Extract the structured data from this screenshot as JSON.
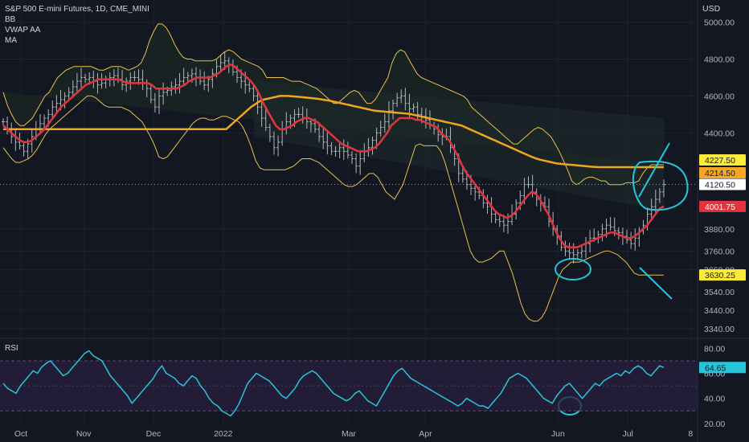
{
  "header": {
    "symbol_line": "S&P 500 E-mini Futures, 1D, CME_MINI",
    "indicators": [
      "BB",
      "VWAP AA",
      "MA"
    ]
  },
  "currency": "USD",
  "rsi_label": "RSI",
  "colors": {
    "background": "#131722",
    "grid": "#1e222d",
    "bb_band": "#e9c14a",
    "bb_fill": "#1a2424",
    "ma_fast": "#e0353f",
    "ma_slow": "#f0a520",
    "candles": "#b2b5be",
    "rsi_line": "#26c6da",
    "rsi_band": "#2a1f3d",
    "annotation": "#26c6da",
    "label_last": "#ffffff",
    "label_upper": "#ffeb3b",
    "label_slow": "#f5a623",
    "label_fast": "#e0353f",
    "label_lower": "#ffeb3b",
    "label_rsi": "#26c6da"
  },
  "chart_data": [
    {
      "type": "line",
      "title": "S&P 500 E-mini Futures, 1D, CME_MINI",
      "x_ticks": [
        "Oct",
        "Nov",
        "Dec",
        "2022",
        "Mar",
        "Apr",
        "Jun",
        "Jul",
        "8"
      ],
      "y_ticks": [
        3340,
        3440,
        3540,
        3660,
        3760,
        3880,
        4000,
        4120,
        4400,
        4600,
        4800,
        5000
      ],
      "y_tick_labels": [
        "3340.00",
        "3440.00",
        "3540.00",
        "3660.00",
        "3760.00",
        "3880.00",
        "4001.75",
        "4120.50",
        "4400.00",
        "4600.00",
        "4800.00",
        "5000.00"
      ],
      "ylim": [
        3300,
        5120
      ],
      "price_labels": [
        {
          "text": "4227.50",
          "value": 4227.5,
          "kind": "upper"
        },
        {
          "text": "4214.50",
          "value": 4214.5,
          "kind": "slow"
        },
        {
          "text": "4120.50",
          "value": 4120.5,
          "kind": "last"
        },
        {
          "text": "4001.75",
          "value": 4001.75,
          "kind": "fast"
        },
        {
          "text": "3630.25",
          "value": 3630.25,
          "kind": "lower"
        }
      ],
      "closes": [
        4460,
        4420,
        4380,
        4350,
        4330,
        4300,
        4340,
        4380,
        4420,
        4450,
        4480,
        4500,
        4540,
        4560,
        4580,
        4600,
        4620,
        4650,
        4680,
        4700,
        4690,
        4700,
        4680,
        4660,
        4670,
        4690,
        4700,
        4710,
        4690,
        4660,
        4680,
        4700,
        4700,
        4690,
        4670,
        4640,
        4580,
        4540,
        4600,
        4620,
        4630,
        4650,
        4660,
        4680,
        4700,
        4710,
        4720,
        4700,
        4680,
        4660,
        4690,
        4720,
        4760,
        4780,
        4790,
        4770,
        4730,
        4700,
        4680,
        4660,
        4640,
        4600,
        4540,
        4480,
        4430,
        4380,
        4320,
        4350,
        4420,
        4460,
        4480,
        4500,
        4500,
        4480,
        4460,
        4450,
        4420,
        4380,
        4350,
        4330,
        4300,
        4300,
        4320,
        4300,
        4280,
        4260,
        4220,
        4260,
        4300,
        4320,
        4360,
        4400,
        4430,
        4460,
        4520,
        4560,
        4590,
        4600,
        4560,
        4530,
        4540,
        4500,
        4490,
        4470,
        4440,
        4420,
        4390,
        4380,
        4380,
        4320,
        4260,
        4180,
        4150,
        4120,
        4100,
        4080,
        4060,
        4020,
        4000,
        3960,
        3930,
        3920,
        3900,
        3920,
        3960,
        4020,
        4060,
        4120,
        4120,
        4080,
        4040,
        4020,
        4000,
        3920,
        3880,
        3840,
        3780,
        3760,
        3750,
        3740,
        3750,
        3760,
        3800,
        3830,
        3830,
        3850,
        3880,
        3900,
        3890,
        3870,
        3860,
        3840,
        3820,
        3800,
        3830,
        3870,
        3900,
        3960,
        4000,
        4040,
        4080,
        4120
      ],
      "series": [
        {
          "name": "BB upper",
          "y": [
            4620,
            4550,
            4500,
            4460,
            4440,
            4440,
            4460,
            4480,
            4520,
            4560,
            4600,
            4620,
            4660,
            4700,
            4720,
            4740,
            4750,
            4760,
            4760,
            4760,
            4760,
            4760,
            4750,
            4740,
            4740,
            4750,
            4760,
            4760,
            4760,
            4750,
            4740,
            4750,
            4760,
            4780,
            4830,
            4900,
            4950,
            4990,
            4990,
            4970,
            4930,
            4880,
            4840,
            4810,
            4800,
            4800,
            4790,
            4790,
            4790,
            4790,
            4790,
            4800,
            4820,
            4840,
            4850,
            4840,
            4820,
            4800,
            4790,
            4780,
            4770,
            4760,
            4740,
            4700,
            4700,
            4700,
            4700,
            4700,
            4690,
            4680,
            4680,
            4680,
            4670,
            4660,
            4650,
            4640,
            4620,
            4600,
            4580,
            4560,
            4560,
            4580,
            4600,
            4620,
            4630,
            4620,
            4590,
            4560,
            4560,
            4580,
            4620,
            4660,
            4700,
            4780,
            4830,
            4850,
            4840,
            4800,
            4760,
            4720,
            4700,
            4690,
            4680,
            4670,
            4660,
            4650,
            4640,
            4630,
            4620,
            4610,
            4600,
            4580,
            4540,
            4520,
            4500,
            4480,
            4460,
            4440,
            4420,
            4400,
            4380,
            4360,
            4340,
            4340,
            4360,
            4380,
            4400,
            4420,
            4430,
            4420,
            4400,
            4380,
            4340,
            4300,
            4250,
            4200,
            4140,
            4120,
            4130,
            4150,
            4160,
            4160,
            4150,
            4140,
            4140,
            4120,
            4120,
            4120,
            4120,
            4130,
            4130,
            4130,
            4140,
            4180,
            4210,
            4227.5,
            4227.5,
            4227.5,
            4227.5
          ]
        },
        {
          "name": "BB lower",
          "y": [
            4320,
            4290,
            4260,
            4240,
            4240,
            4250,
            4260,
            4280,
            4310,
            4350,
            4390,
            4420,
            4440,
            4460,
            4480,
            4500,
            4520,
            4540,
            4560,
            4580,
            4600,
            4600,
            4590,
            4570,
            4550,
            4540,
            4540,
            4540,
            4540,
            4530,
            4520,
            4500,
            4480,
            4460,
            4420,
            4380,
            4330,
            4270,
            4260,
            4270,
            4300,
            4330,
            4360,
            4390,
            4420,
            4450,
            4470,
            4480,
            4480,
            4470,
            4470,
            4480,
            4490,
            4490,
            4480,
            4470,
            4460,
            4430,
            4380,
            4320,
            4250,
            4210,
            4200,
            4200,
            4200,
            4200,
            4200,
            4200,
            4210,
            4220,
            4240,
            4260,
            4260,
            4260,
            4250,
            4240,
            4220,
            4200,
            4180,
            4160,
            4140,
            4120,
            4110,
            4110,
            4120,
            4140,
            4160,
            4180,
            4180,
            4160,
            4120,
            4080,
            4060,
            4040,
            4080,
            4120,
            4190,
            4260,
            4330,
            4340,
            4330,
            4330,
            4330,
            4330,
            4300,
            4240,
            4160,
            4080,
            4000,
            3920,
            3840,
            3760,
            3720,
            3700,
            3700,
            3710,
            3720,
            3740,
            3760,
            3760,
            3700,
            3640,
            3560,
            3480,
            3420,
            3390,
            3380,
            3380,
            3400,
            3440,
            3500,
            3560,
            3620,
            3660,
            3680,
            3700,
            3700,
            3700,
            3710,
            3720,
            3730,
            3740,
            3750,
            3760,
            3760,
            3750,
            3740,
            3720,
            3700,
            3670,
            3640,
            3630.25,
            3630.25,
            3630.25,
            3630.25,
            3630.25,
            3630.25,
            3630.25
          ]
        },
        {
          "name": "MA fast",
          "y": [
            4440,
            4420,
            4400,
            4380,
            4360,
            4350,
            4350,
            4360,
            4380,
            4400,
            4420,
            4450,
            4480,
            4510,
            4540,
            4560,
            4580,
            4600,
            4620,
            4640,
            4660,
            4670,
            4680,
            4690,
            4690,
            4690,
            4690,
            4690,
            4690,
            4680,
            4670,
            4670,
            4670,
            4670,
            4670,
            4670,
            4660,
            4640,
            4640,
            4640,
            4640,
            4640,
            4640,
            4650,
            4660,
            4680,
            4690,
            4700,
            4700,
            4700,
            4700,
            4710,
            4720,
            4740,
            4760,
            4770,
            4760,
            4740,
            4720,
            4700,
            4680,
            4650,
            4610,
            4560,
            4520,
            4480,
            4440,
            4420,
            4420,
            4430,
            4440,
            4460,
            4470,
            4480,
            4480,
            4470,
            4460,
            4440,
            4420,
            4400,
            4380,
            4360,
            4340,
            4330,
            4320,
            4310,
            4300,
            4300,
            4300,
            4310,
            4320,
            4340,
            4370,
            4400,
            4440,
            4460,
            4480,
            4480,
            4480,
            4480,
            4470,
            4470,
            4460,
            4450,
            4440,
            4430,
            4400,
            4380,
            4360,
            4320,
            4280,
            4230,
            4190,
            4160,
            4130,
            4100,
            4070,
            4040,
            4010,
            3980,
            3960,
            3950,
            3940,
            3950,
            3970,
            4000,
            4030,
            4060,
            4080,
            4070,
            4040,
            4000,
            3960,
            3910,
            3860,
            3820,
            3790,
            3780,
            3780,
            3780,
            3790,
            3800,
            3810,
            3820,
            3830,
            3840,
            3850,
            3860,
            3860,
            3850,
            3840,
            3830,
            3830,
            3840,
            3860,
            3880,
            3900,
            3930,
            3960,
            3990,
            4001.75
          ]
        },
        {
          "name": "MA slow",
          "y": [
            4420,
            4420,
            4420,
            4420,
            4420,
            4420,
            4420,
            4420,
            4420,
            4420,
            4420,
            4420,
            4420,
            4420,
            4420,
            4420,
            4420,
            4420,
            4420,
            4420,
            4420,
            4420,
            4420,
            4420,
            4420,
            4420,
            4420,
            4420,
            4420,
            4420,
            4420,
            4420,
            4420,
            4420,
            4420,
            4420,
            4420,
            4420,
            4420,
            4420,
            4420,
            4420,
            4420,
            4420,
            4420,
            4420,
            4420,
            4420,
            4420,
            4420,
            4420,
            4420,
            4420,
            4420,
            4420,
            4440,
            4460,
            4480,
            4500,
            4520,
            4540,
            4555,
            4570,
            4580,
            4585,
            4590,
            4595,
            4600,
            4600,
            4600,
            4598,
            4596,
            4594,
            4592,
            4590,
            4588,
            4585,
            4582,
            4578,
            4575,
            4570,
            4565,
            4560,
            4555,
            4550,
            4545,
            4540,
            4535,
            4530,
            4525,
            4520,
            4518,
            4516,
            4514,
            4512,
            4510,
            4508,
            4506,
            4504,
            4500,
            4495,
            4490,
            4485,
            4480,
            4475,
            4470,
            4465,
            4460,
            4455,
            4450,
            4445,
            4440,
            4430,
            4420,
            4410,
            4400,
            4390,
            4380,
            4370,
            4360,
            4350,
            4340,
            4330,
            4320,
            4310,
            4300,
            4290,
            4280,
            4270,
            4262,
            4255,
            4250,
            4245,
            4240,
            4235,
            4232,
            4230,
            4228,
            4226,
            4224,
            4222,
            4220,
            4218,
            4216,
            4215,
            4214.5,
            4214.5,
            4214.5,
            4214.5,
            4214.5,
            4214.5,
            4214.5,
            4214.5,
            4214.5,
            4214.5,
            4214.5,
            4214.5,
            4214.5,
            4214.5,
            4214.5,
            4214.5
          ]
        }
      ],
      "annotations": [
        "circle at June low",
        "ellipse near current price",
        "upward line",
        "downward line"
      ]
    },
    {
      "type": "line",
      "title": "RSI",
      "y_ticks": [
        20,
        40,
        60,
        80
      ],
      "y_tick_labels": [
        "20.00",
        "40.00",
        "60.00",
        "80.00"
      ],
      "ylim": [
        18,
        86
      ],
      "band": [
        30,
        70
      ],
      "last_label": "64.65",
      "last_value": 64.65,
      "series": [
        {
          "name": "RSI",
          "y": [
            52,
            48,
            46,
            44,
            50,
            54,
            58,
            62,
            60,
            65,
            68,
            70,
            66,
            62,
            58,
            60,
            64,
            68,
            72,
            76,
            78,
            74,
            72,
            70,
            64,
            58,
            54,
            50,
            46,
            42,
            36,
            40,
            44,
            48,
            52,
            56,
            62,
            66,
            60,
            58,
            56,
            52,
            50,
            54,
            58,
            56,
            50,
            46,
            40,
            36,
            34,
            30,
            28,
            26,
            30,
            36,
            44,
            52,
            56,
            60,
            58,
            56,
            54,
            50,
            46,
            42,
            40,
            44,
            48,
            54,
            58,
            60,
            62,
            60,
            56,
            52,
            48,
            44,
            42,
            40,
            38,
            40,
            44,
            46,
            42,
            38,
            36,
            34,
            40,
            46,
            52,
            58,
            62,
            64,
            60,
            56,
            54,
            52,
            50,
            48,
            46,
            44,
            42,
            40,
            38,
            36,
            34,
            36,
            40,
            38,
            36,
            34,
            34,
            32,
            36,
            40,
            44,
            50,
            56,
            58,
            60,
            58,
            56,
            52,
            48,
            44,
            40,
            38,
            36,
            42,
            46,
            50,
            52,
            48,
            44,
            40,
            44,
            48,
            52,
            50,
            54,
            56,
            58,
            60,
            58,
            62,
            60,
            64,
            66,
            64,
            60,
            58,
            62,
            66,
            64.65
          ]
        }
      ],
      "annotations": [
        "circle at June RSI low"
      ]
    }
  ]
}
